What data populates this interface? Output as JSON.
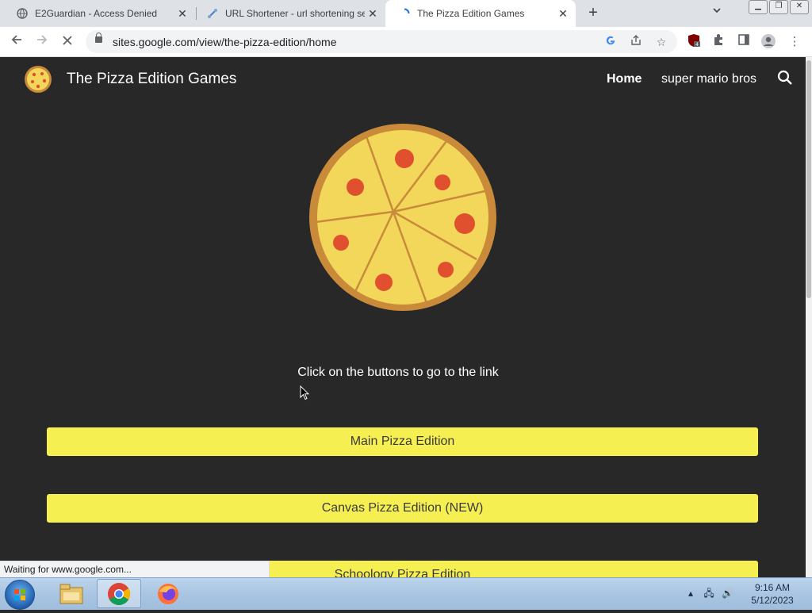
{
  "browser": {
    "tabs": [
      {
        "title": "E2Guardian - Access Denied",
        "active": false
      },
      {
        "title": "URL Shortener - url shortening se",
        "active": false
      },
      {
        "title": "The Pizza Edition Games",
        "active": true
      }
    ],
    "url": "sites.google.com/view/the-pizza-edition/home",
    "extension_badge": "4",
    "status_text": "Waiting for www.google.com..."
  },
  "site": {
    "name": "The Pizza Edition Games",
    "nav": [
      {
        "label": "Home",
        "active": true
      },
      {
        "label": "super mario bros",
        "active": false
      }
    ],
    "instruction": "Click on the buttons to go to the link",
    "buttons": [
      {
        "label": "Main Pizza Edition"
      },
      {
        "label": "Canvas Pizza Edition (NEW)"
      },
      {
        "label": "Schoology Pizza Edition"
      }
    ]
  },
  "taskbar": {
    "time": "9:16 AM",
    "date": "5/12/2023"
  },
  "colors": {
    "site_bg": "#282828",
    "button_yellow": "#f5ef52",
    "pizza_crust": "#c98a3a",
    "pizza_cheese": "#f2d75a",
    "pepperoni": "#e0502e"
  }
}
